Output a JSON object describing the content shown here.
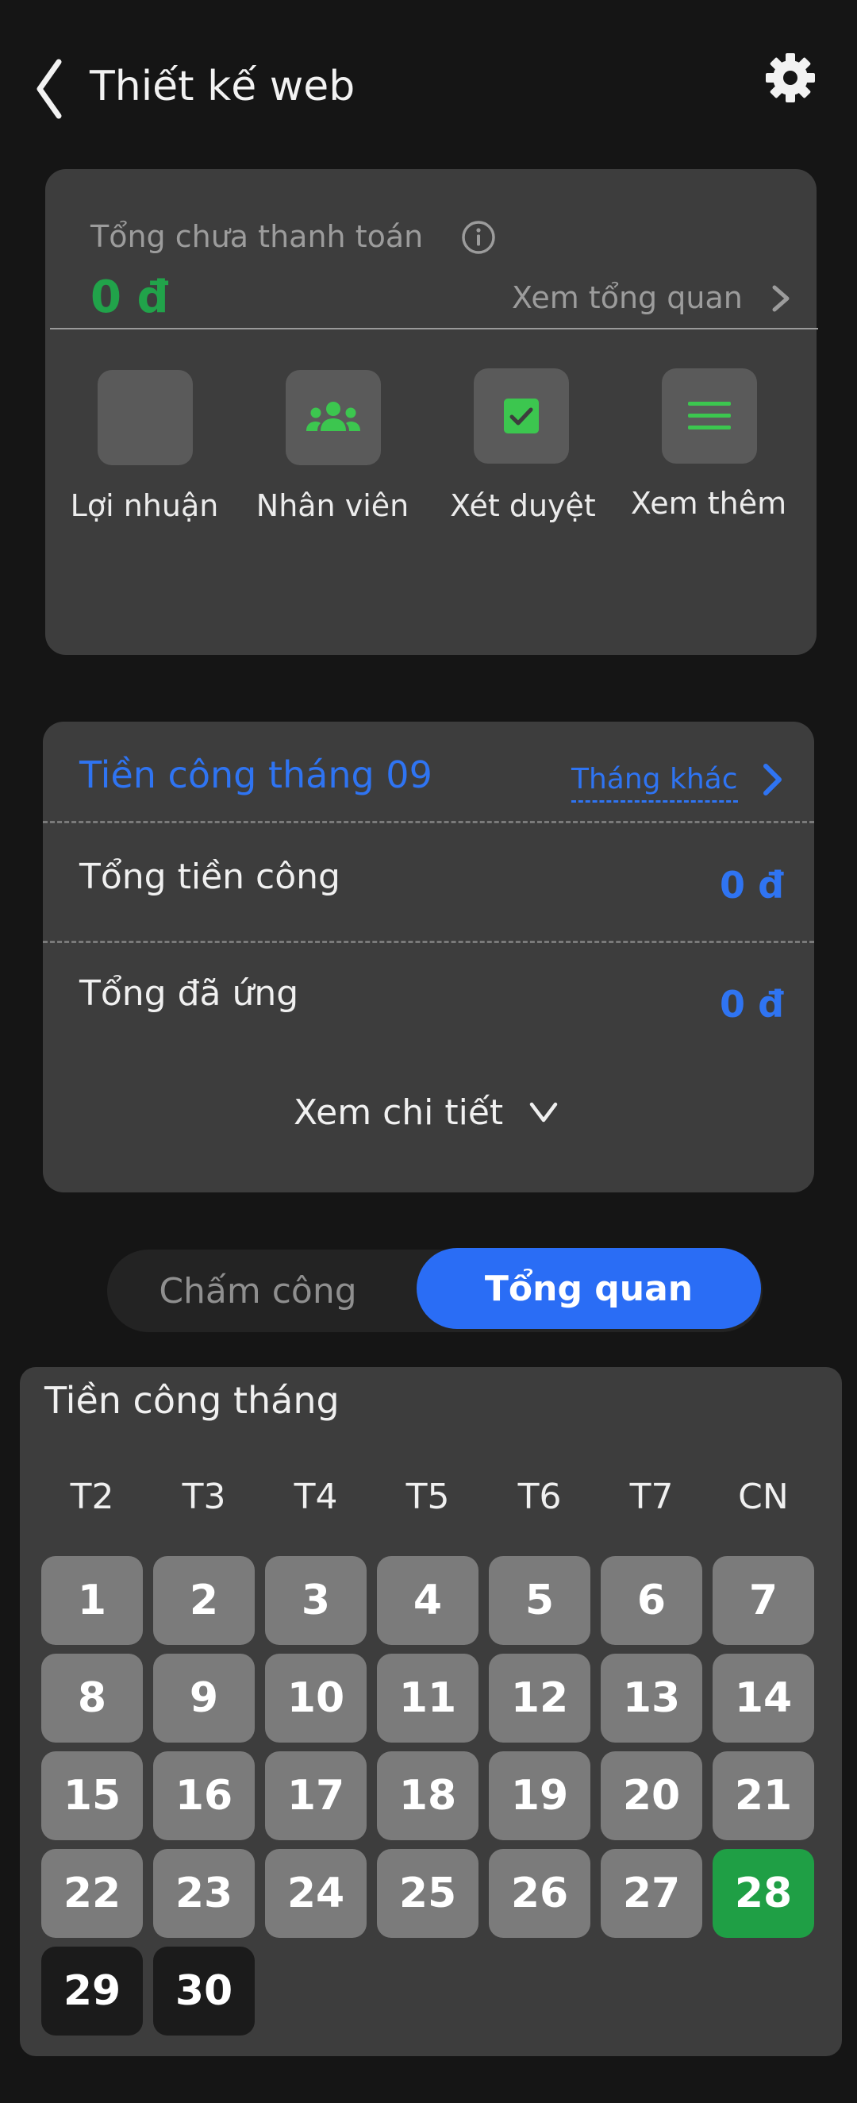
{
  "header": {
    "title": "Thiết kế web"
  },
  "unpaid": {
    "label": "Tổng chưa thanh toán",
    "amount": "0 đ",
    "overview_link": "Xem tổng quan",
    "amount_color": "#21a34a"
  },
  "shortcuts": [
    {
      "label": "Lợi nhuận",
      "icon": "blank-icon"
    },
    {
      "label": "Nhân viên",
      "icon": "group-icon"
    },
    {
      "label": "Xét duyệt",
      "icon": "checkbox-icon"
    },
    {
      "label": "Xem thêm",
      "icon": "menu-icon"
    }
  ],
  "wages": {
    "title": "Tiền công tháng 09",
    "other_month": "Tháng khác",
    "rows": [
      {
        "label": "Tổng tiền công",
        "value": "0 đ"
      },
      {
        "label": "Tổng đã ứng",
        "value": "0 đ"
      }
    ],
    "detail": "Xem chi tiết",
    "accent": "#2f74f2"
  },
  "tabs": {
    "left": "Chấm công",
    "right": "Tổng quan",
    "active": "Tổng quan"
  },
  "calendar": {
    "title": "Tiền công tháng",
    "weekdays": [
      "T2",
      "T3",
      "T4",
      "T5",
      "T6",
      "T7",
      "CN"
    ],
    "days": [
      "1",
      "2",
      "3",
      "4",
      "5",
      "6",
      "7",
      "8",
      "9",
      "10",
      "11",
      "12",
      "13",
      "14",
      "15",
      "16",
      "17",
      "18",
      "19",
      "20",
      "21",
      "22",
      "23",
      "24",
      "25",
      "26",
      "27",
      "28",
      "29",
      "30"
    ],
    "today": "28",
    "colors": {
      "past": "#7b7b7b",
      "today": "#1f9f45",
      "future": "#1b1b1b"
    }
  }
}
